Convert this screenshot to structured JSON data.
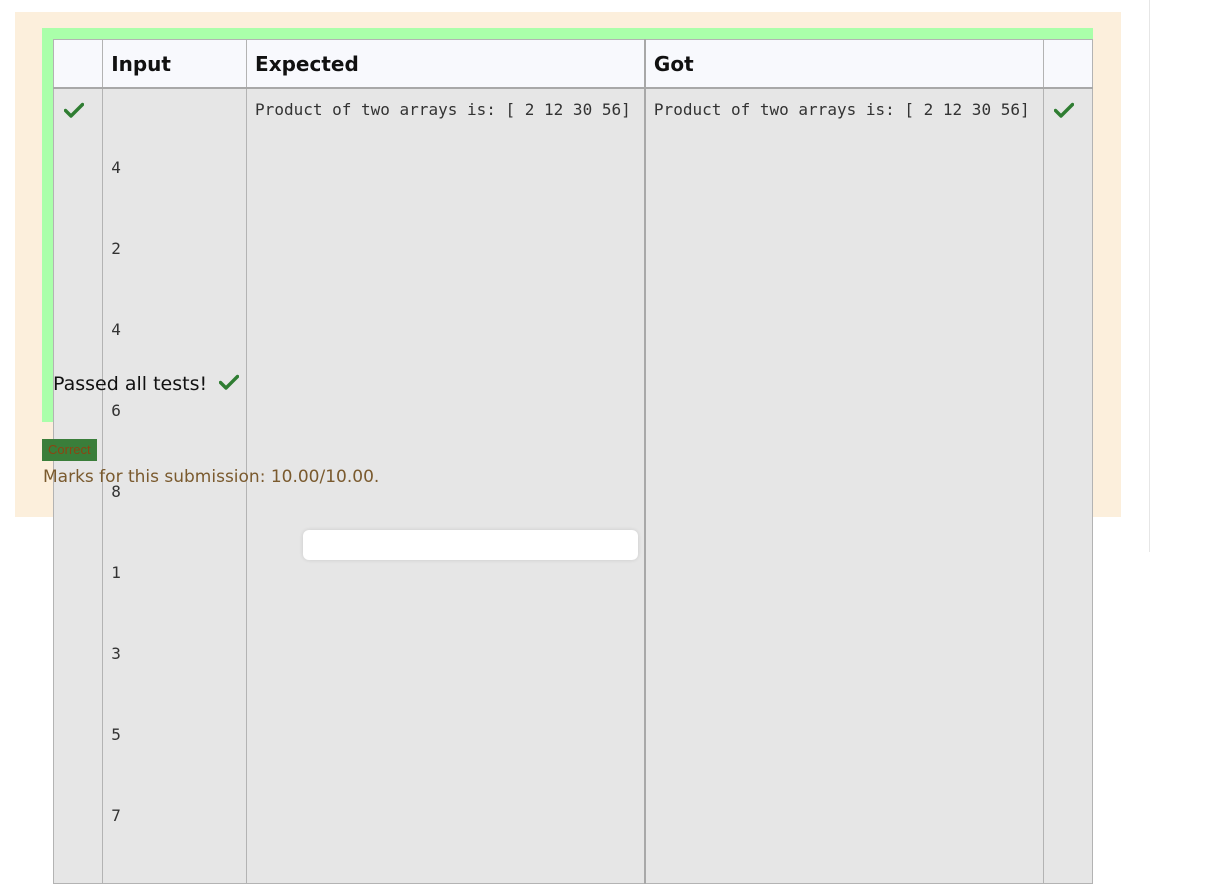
{
  "table": {
    "headers": {
      "check": "",
      "input": "Input",
      "expected": "Expected",
      "got": "Got",
      "mark": ""
    },
    "rows": [
      {
        "input_lines": [
          "4",
          "2",
          "4",
          "6",
          "8",
          "1",
          "3",
          "5",
          "7"
        ],
        "expected": "Product of two arrays is: [ 2 12 30 56]",
        "got": "Product of two arrays is: [ 2 12 30 56]",
        "row_icon": "check-icon",
        "mark_icon": "check-icon"
      }
    ]
  },
  "summary": {
    "passed_text": "Passed all tests!",
    "passed_icon": "check-icon"
  },
  "status": {
    "badge_label": "Correct",
    "marks_text": "Marks for this submission: 10.00/10.00."
  },
  "colors": {
    "panel_bg": "#fcefdc",
    "success_bg": "#aaffaa",
    "check_green": "#2f7d32",
    "badge_bg": "#3a7e3a"
  }
}
